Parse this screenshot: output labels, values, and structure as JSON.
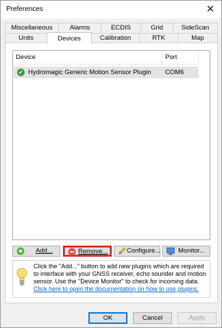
{
  "window": {
    "title": "Preferences"
  },
  "tabs_back": [
    "Miscellaneous",
    "Alarms",
    "ECDIS",
    "Grid",
    "SideScan"
  ],
  "tabs_front": [
    "Units",
    "Devices",
    "Calibration",
    "RTK",
    "Map"
  ],
  "active_tab": "Devices",
  "device_list": {
    "columns": [
      "Device",
      "Port"
    ],
    "rows": [
      {
        "status": "ok",
        "device": "Hydromagic Generic Motion Sensor Plugin",
        "port": "COM6"
      }
    ]
  },
  "buttons": {
    "add": "Add...",
    "remove": "Remove...",
    "configure": "Configure...",
    "monitor": "Monitor..."
  },
  "info": {
    "text": "Click the \"Add...\" button to add new plugins which are required to interface with your GNSS receiver, echo sounder and motion sensor. Use the \"Device Monitor\" to check for incoming data.",
    "link": "Click here to open the documentation on how to use plugins."
  },
  "dialog_buttons": {
    "ok": "OK",
    "cancel": "Cancel",
    "apply": "Apply"
  },
  "colors": {
    "link": "#0066cc",
    "selection": "#e3e3e3",
    "accent": "#0078d7"
  }
}
